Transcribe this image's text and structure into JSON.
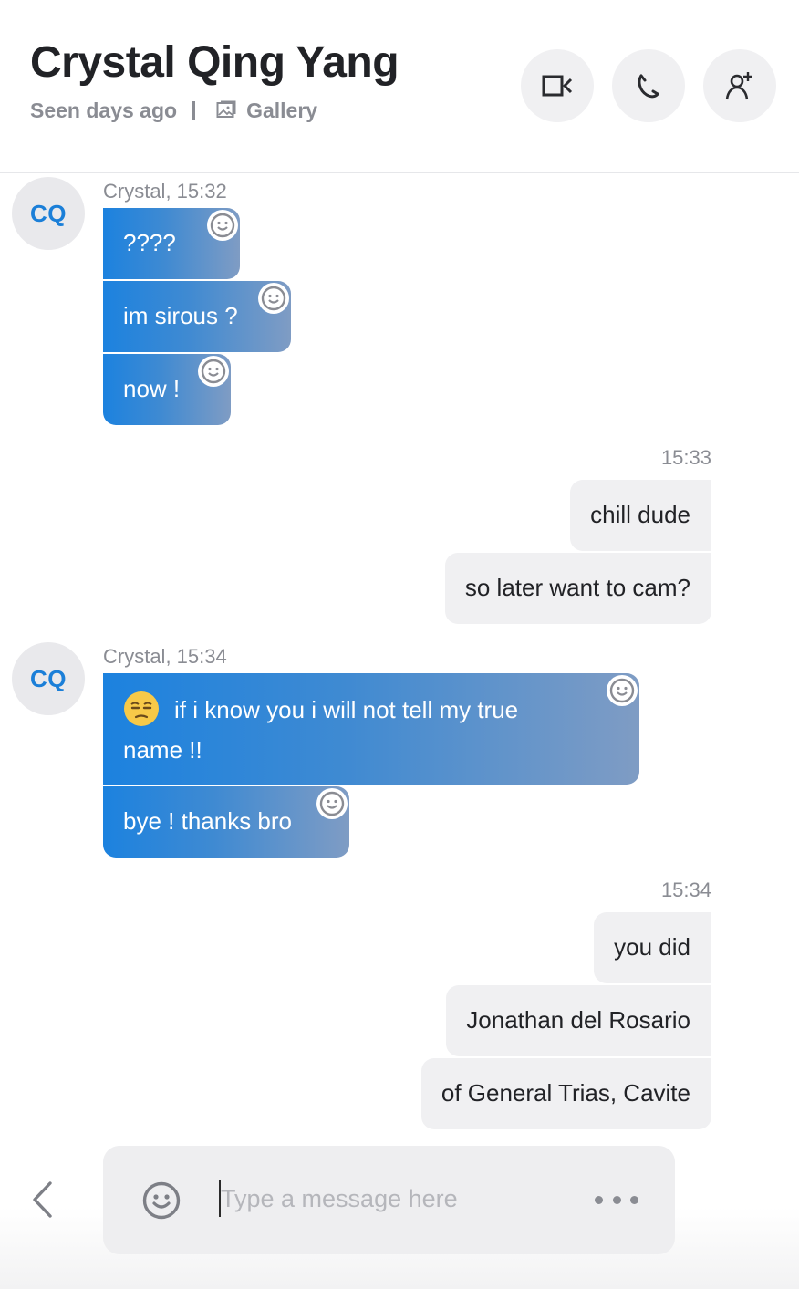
{
  "header": {
    "title": "Crystal Qing Yang",
    "status": "Seen days ago",
    "gallery_label": "Gallery",
    "actions": [
      {
        "name": "video-call",
        "icon": "video-camera-icon"
      },
      {
        "name": "voice-call",
        "icon": "phone-icon"
      },
      {
        "name": "add-participant",
        "icon": "add-person-icon"
      }
    ]
  },
  "conversation": {
    "groups": [
      {
        "sender": "incoming",
        "avatar_initials": "CQ",
        "meta": "Crystal, 15:32",
        "messages": [
          "????",
          "im sirous ?",
          "now !"
        ]
      },
      {
        "sender": "outgoing",
        "meta": "15:33",
        "messages": [
          "chill dude",
          "so later want to cam?"
        ]
      },
      {
        "sender": "incoming",
        "avatar_initials": "CQ",
        "meta": "Crystal, 15:34",
        "messages": [
          {
            "emoji": "unamused-face-emoji",
            "line1": "if i know you i will not tell my true",
            "line2": "name !!"
          },
          "bye ! thanks bro"
        ]
      },
      {
        "sender": "outgoing",
        "meta": "15:34",
        "messages": [
          "you did",
          "Jonathan del Rosario",
          "of General Trias, Cavite"
        ]
      }
    ]
  },
  "composer": {
    "placeholder": "Type a message here",
    "value": ""
  },
  "colors": {
    "accent": "#1c82df",
    "incoming_gradient_end": "#7f9cc4",
    "outgoing_bubble": "#f0f0f2",
    "muted_text": "#8a8c93"
  }
}
